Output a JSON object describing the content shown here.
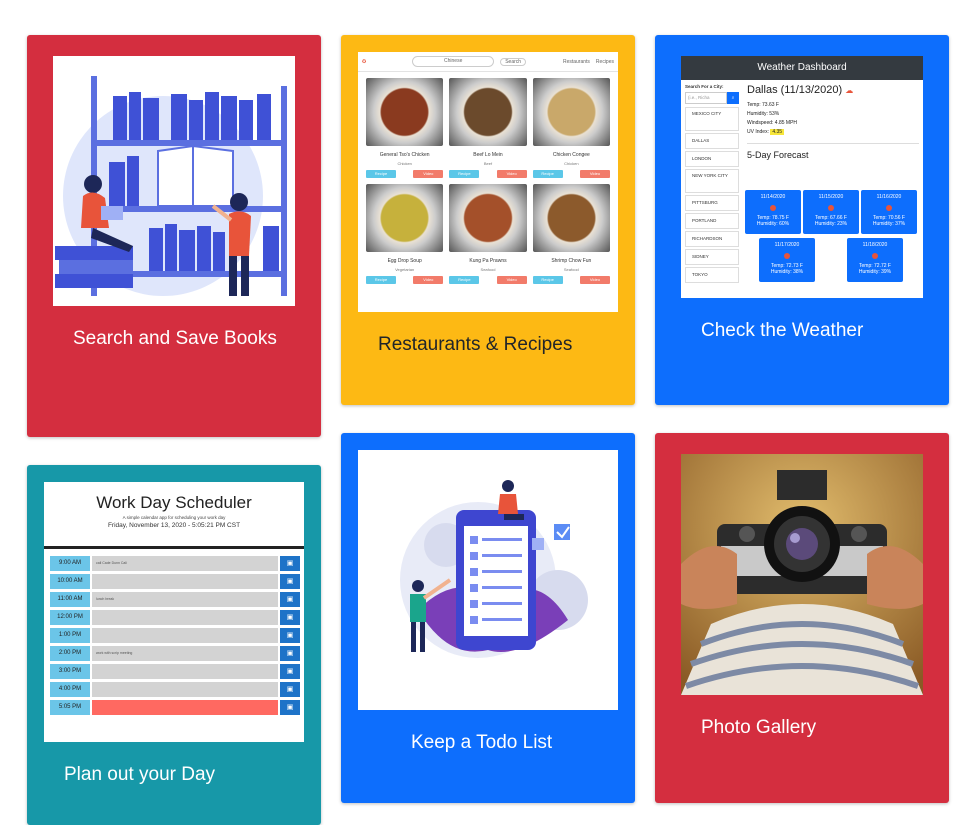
{
  "cards": [
    {
      "title": "Search and Save Books",
      "color": "#d42e3f"
    },
    {
      "title": "Restaurants & Recipes",
      "color": "#fdb914"
    },
    {
      "title": "Check the Weather",
      "color": "#0d6efd"
    },
    {
      "title": "Plan out your Day",
      "color": "#1798a8"
    },
    {
      "title": "Keep a Todo List",
      "color": "#0d6efd"
    },
    {
      "title": "Photo Gallery",
      "color": "#d42e3f"
    }
  ],
  "recipes": {
    "search_placeholder": "Chinese",
    "search_button": "Search",
    "nav_links": [
      "Restaurants",
      "Recipes"
    ],
    "items": [
      {
        "name": "General Tso's Chicken",
        "sub": "Chicken",
        "recipe": "Recipe",
        "video": "Video",
        "color": "#8a3a1f"
      },
      {
        "name": "Beef Lo Mein",
        "sub": "Beef",
        "recipe": "Recipe",
        "video": "Video",
        "color": "#6b4a2c"
      },
      {
        "name": "Chicken Congee",
        "sub": "Chicken",
        "recipe": "Recipe",
        "video": "Video",
        "color": "#c9a86a"
      },
      {
        "name": "Egg Drop Soup",
        "sub": "Vegetarian",
        "recipe": "Recipe",
        "video": "Video",
        "color": "#c6b13c"
      },
      {
        "name": "Kung Pa Prawns",
        "sub": "Seafood",
        "recipe": "Recipe",
        "video": "Video",
        "color": "#a4502a"
      },
      {
        "name": "Shrimp Chow Fun",
        "sub": "Seafood",
        "recipe": "Recipe",
        "video": "Video",
        "color": "#8c5a2c"
      }
    ]
  },
  "weather": {
    "header": "Weather Dashboard",
    "search_label": "Search For a City:",
    "search_placeholder": "(i.e., Richa",
    "cities": [
      "Mexico City",
      "Dallas",
      "London",
      "New York City",
      "Pittsburg",
      "Portland",
      "Richardson",
      "Sidney",
      "Tokyo"
    ],
    "current": {
      "city_date": "Dallas (11/13/2020)",
      "temp": "Temp: 73.63 F",
      "humidity": "Humidity: 53%",
      "wind": "Windspeed: 4.85 MPH",
      "uv_label": "UV Index:",
      "uv_value": "4.35"
    },
    "forecast_title": "5-Day Forecast",
    "forecast": [
      {
        "date": "11/14/2020",
        "temp": "Temp: 78.75 F",
        "hum": "Humidity: 60%"
      },
      {
        "date": "11/15/2020",
        "temp": "Temp: 67.66 F",
        "hum": "Humidity: 23%"
      },
      {
        "date": "11/16/2020",
        "temp": "Temp: 70.56 F",
        "hum": "Humidity: 37%"
      },
      {
        "date": "11/17/2020",
        "temp": "Temp: 72.73 F",
        "hum": "Humidity: 38%"
      },
      {
        "date": "11/18/2020",
        "temp": "Temp: 72.72 F",
        "hum": "Humidity: 39%"
      }
    ]
  },
  "scheduler": {
    "title": "Work Day Scheduler",
    "subtitle": "A simple calendar app for scheduling your work day",
    "date": "Friday, November 13, 2020 - 5:05:21 PM CST",
    "rows": [
      {
        "hour": "9:00 AM",
        "text": "call Cade Dunn Cali"
      },
      {
        "hour": "10:00 AM",
        "text": ""
      },
      {
        "hour": "11:00 AM",
        "text": "lunch break"
      },
      {
        "hour": "12:00 PM",
        "text": ""
      },
      {
        "hour": "1:00 PM",
        "text": ""
      },
      {
        "hour": "2:00 PM",
        "text": "work with scrip meeting"
      },
      {
        "hour": "3:00 PM",
        "text": ""
      },
      {
        "hour": "4:00 PM",
        "text": ""
      },
      {
        "hour": "5:05 PM",
        "text": ""
      }
    ]
  }
}
